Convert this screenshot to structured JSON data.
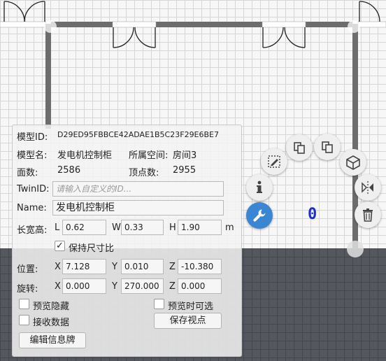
{
  "panel": {
    "model_id_label": "模型ID:",
    "model_id_value": "D29ED95FBBCE42ADAE1B5C23F29E6BE7",
    "model_name_label": "模型名:",
    "model_name_value": "发电机控制柜",
    "space_label": "所属空间:",
    "space_value": "房间3",
    "faces_label": "面数:",
    "faces_value": "2586",
    "vertices_label": "顶点数:",
    "vertices_value": "2955",
    "twinid_label": "TwinID:",
    "twinid_placeholder": "请输入自定义的ID...",
    "name_label": "Name:",
    "name_value": "发电机控制柜",
    "size_label": "长宽高:",
    "L_label": "L",
    "L_value": "0.62",
    "W_label": "W",
    "W_value": "0.33",
    "H_label": "H",
    "H_value": "1.90",
    "unit_label": "m",
    "keep_ratio_label": "保持尺寸比",
    "keep_ratio_checked": true,
    "position_label": "位置:",
    "pos_x_label": "X",
    "pos_x": "7.128",
    "pos_y_label": "Y",
    "pos_y": "0.010",
    "pos_z_label": "Z",
    "pos_z": "-10.380",
    "rotation_label": "旋转:",
    "rot_x_label": "X",
    "rot_x": "0.000",
    "rot_y_label": "Y",
    "rot_y": "270.000",
    "rot_z_label": "Z",
    "rot_z": "0.000",
    "preview_hide_label": "预览隐藏",
    "preview_selectable_label": "预览时可选",
    "receive_data_label": "接收数据",
    "save_view_label": "保存视点",
    "edit_sign_label": "编辑信息牌"
  },
  "selection_marker": "0",
  "tools": [
    "copy-icon",
    "paste-copy-icon",
    "cube-icon",
    "edit-image-icon",
    "info-icon",
    "mirror-icon",
    "wrench-icon",
    "trash-icon"
  ],
  "colors": {
    "accent": "#3a86d3",
    "marker": "#1a2fd0"
  }
}
